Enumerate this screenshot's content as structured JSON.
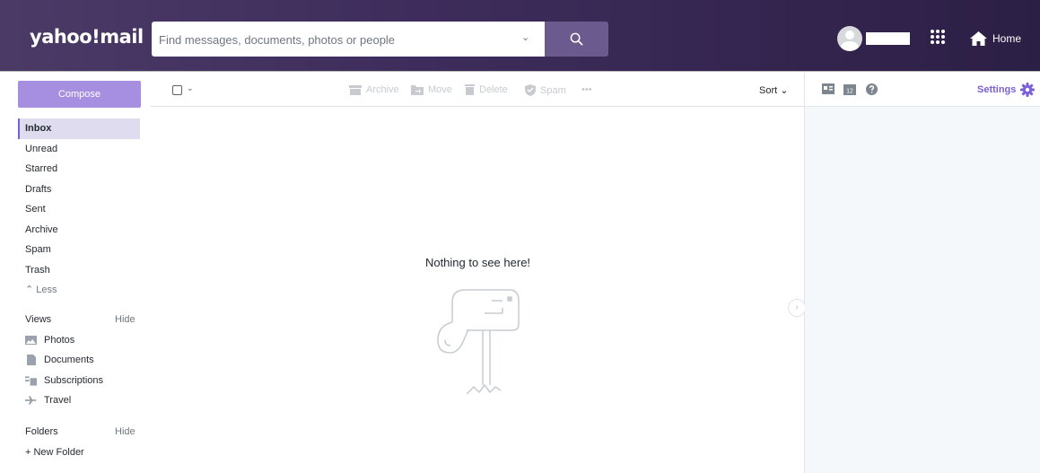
{
  "header": {
    "logo": "yahoo!mail",
    "search_placeholder": "Find messages, documents, photos or people",
    "home_label": "Home"
  },
  "sidebar": {
    "compose_label": "Compose",
    "folders": [
      {
        "label": "Inbox",
        "active": true
      },
      {
        "label": "Unread"
      },
      {
        "label": "Starred"
      },
      {
        "label": "Drafts"
      },
      {
        "label": "Sent"
      },
      {
        "label": "Archive"
      },
      {
        "label": "Spam"
      },
      {
        "label": "Trash"
      }
    ],
    "less_label": "Less",
    "views_title": "Views",
    "views_hide": "Hide",
    "views": [
      "Photos",
      "Documents",
      "Subscriptions",
      "Travel"
    ],
    "folders_title": "Folders",
    "folders_hide": "Hide",
    "new_folder_label": "+ New Folder"
  },
  "toolbar": {
    "archive": "Archive",
    "move": "Move",
    "delete": "Delete",
    "spam": "Spam",
    "more": "•••",
    "sort": "Sort"
  },
  "main": {
    "empty_message": "Nothing to see here!"
  },
  "right_pane": {
    "calendar_day": "12",
    "settings_label": "Settings"
  },
  "colors": {
    "header": "#3e2d5c",
    "accent": "#7b5fd6",
    "compose": "#a68fe0"
  }
}
